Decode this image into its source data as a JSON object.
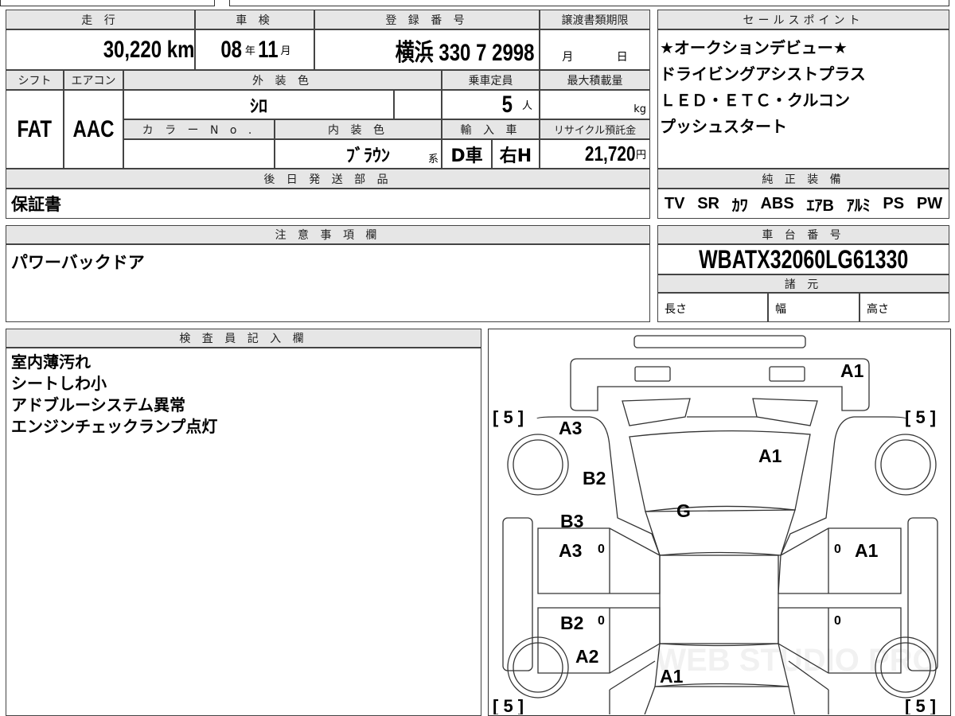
{
  "top_table": {
    "mileage_label": "走 行",
    "mileage_value": "30,220",
    "mileage_unit": "km",
    "inspection_label": "車 検",
    "inspection_year": "08",
    "year_unit": "年",
    "inspection_month": "11",
    "month_unit": "月",
    "registration_label": "登 録 番 号",
    "registration_value": "横浜 330 7 2998",
    "transfer_deadline_label": "譲渡書類期限",
    "transfer_month_unit": "月",
    "transfer_day_unit": "日",
    "shift_label": "シフト",
    "shift_value": "FAT",
    "aircon_label": "エアコン",
    "aircon_value": "AAC",
    "exterior_color_label": "外 装 色",
    "exterior_color_value": "ｼﾛ",
    "capacity_label": "乗車定員",
    "capacity_value": "5",
    "capacity_unit": "人",
    "max_load_label": "最大積載量",
    "max_load_unit": "kg",
    "color_no_label": "カ ラ ー N o .",
    "interior_color_label": "内 装 色",
    "interior_color_value": "ﾌﾞﾗｳﾝ",
    "interior_suffix": "系",
    "import_label": "輸 入 車",
    "import_value": "D車",
    "handle_value": "右H",
    "recycle_label": "リサイクル預託金",
    "recycle_value": "21,720",
    "recycle_unit": "円",
    "later_parts_label": "後 日 発 送 部 品",
    "later_parts_value": "保証書"
  },
  "sales_points": {
    "label": "セールスポイント",
    "lines": [
      "★オークションデビュー★",
      "ドライビングアシストプラス",
      "ＬＥＤ・ＥＴＣ・クルコン",
      "プッシュスタート"
    ]
  },
  "equipment": {
    "label": "純 正 装 備",
    "items": [
      "TV",
      "SR",
      "ｶﾜ",
      "ABS",
      "ｴｱB",
      "ｱﾙﾐ",
      "PS",
      "PW"
    ]
  },
  "notes": {
    "label": "注 意 事 項 欄",
    "value": "パワーバックドア"
  },
  "chassis": {
    "label": "車 台 番 号",
    "value": "WBATX32060LG61330",
    "specs_label": "諸 元",
    "length": "長さ",
    "width": "幅",
    "height": "高さ"
  },
  "inspector": {
    "label": "検 査 員 記 入 欄",
    "lines": [
      "室内薄汚れ",
      "シートしわ小",
      "アドブルーシステム異常",
      "エンジンチェックランプ点灯"
    ]
  },
  "diagram": {
    "tire_brackets": [
      "[ 5 ]",
      "[ 5 ]",
      "[ 5 ]",
      "[ 5 ]"
    ],
    "marks": {
      "front_bumper": "A1",
      "hood": "A1",
      "windshield": "G",
      "left_front_fender": "A3",
      "left_front_fender_b": "B2",
      "left_front_door_1": "B3",
      "left_front_door_2": "A3",
      "right_front_door": "A1",
      "left_rear_door": "B2",
      "left_rear_fender": "A2",
      "trunk": "A1",
      "left_front_door_0": "0",
      "left_rear_door_0": "0",
      "right_front_door_0": "0",
      "right_rear_door_0": "0"
    },
    "watermark": "WEB STUDIO PRO"
  }
}
